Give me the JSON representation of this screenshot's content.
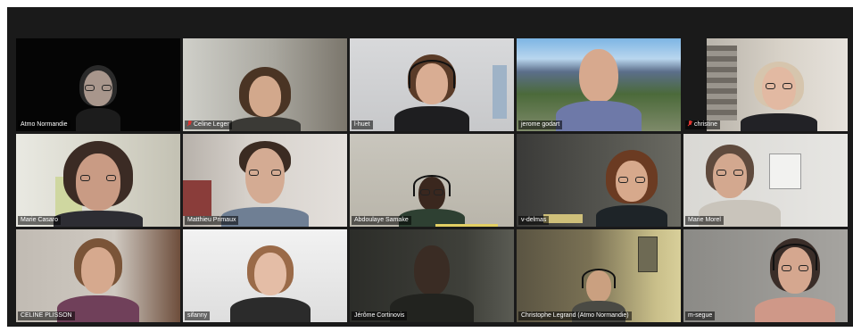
{
  "participants": [
    {
      "name": "Atmo Normandie"
    },
    {
      "name": "Celine Leger",
      "muted": true
    },
    {
      "name": "l-huet"
    },
    {
      "name": "jerome godart"
    },
    {
      "name": "christine",
      "muted": true
    },
    {
      "name": "Marie Casaro",
      "active": true
    },
    {
      "name": "Matthieu Primaux"
    },
    {
      "name": "Abdoulaye Samake"
    },
    {
      "name": "v-delmas"
    },
    {
      "name": "Marie Morel"
    },
    {
      "name": "CELINE PLISSON"
    },
    {
      "name": "sifanny"
    },
    {
      "name": "Jérôme Cortinovis"
    },
    {
      "name": "Christophe Legrand (Atmo Normandie)"
    },
    {
      "name": "m-segue"
    }
  ],
  "colors": {
    "active_speaker_border": "#b7d84b",
    "muted_icon": "#e0332f",
    "background": "#1a1a1a"
  }
}
